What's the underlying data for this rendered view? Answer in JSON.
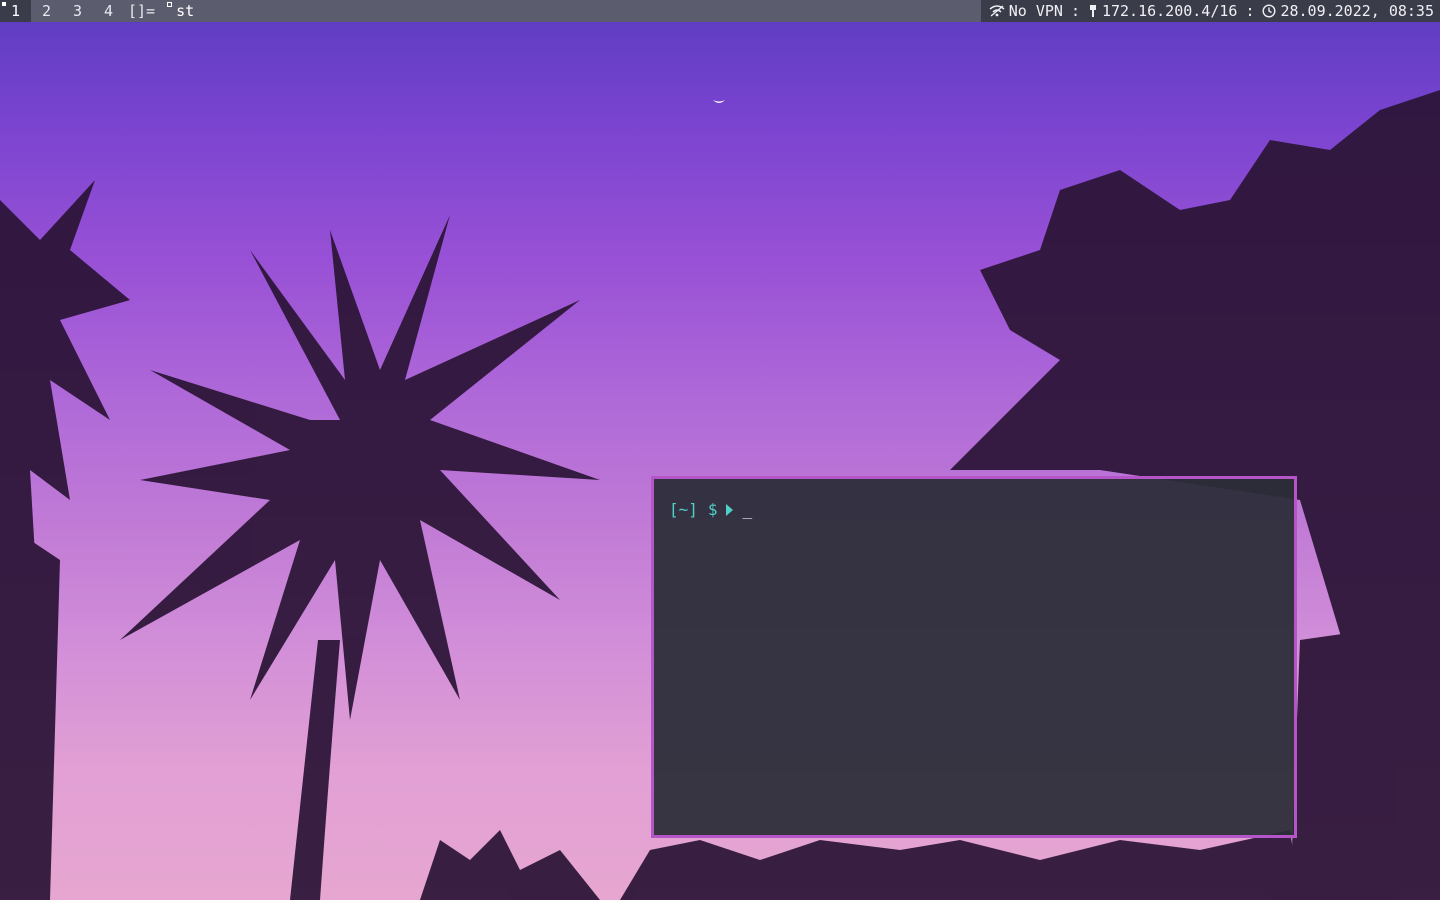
{
  "topbar": {
    "tags": [
      {
        "label": "1",
        "active": true,
        "occupied": true
      },
      {
        "label": "2",
        "active": false,
        "occupied": false
      },
      {
        "label": "3",
        "active": false,
        "occupied": false
      },
      {
        "label": "4",
        "active": false,
        "occupied": false
      }
    ],
    "layout_symbol": "[]=",
    "window_title": "st",
    "status": {
      "vpn_icon": "vpn-icon",
      "vpn": "No VPN",
      "separator": ":",
      "network_icon": "ethernet-icon",
      "ip": "172.16.200.4/16",
      "clock_icon": "clock-icon",
      "datetime": "28.09.2022, 08:35"
    }
  },
  "terminal": {
    "prompt_dir": "[~]",
    "prompt_symbol": "$",
    "cursor": "_",
    "border_color": "#b556c8",
    "text_color": "#4fd1c7"
  },
  "colors": {
    "bar_bg": "#5b5d6e",
    "bar_active_bg": "#3a3c4a"
  }
}
